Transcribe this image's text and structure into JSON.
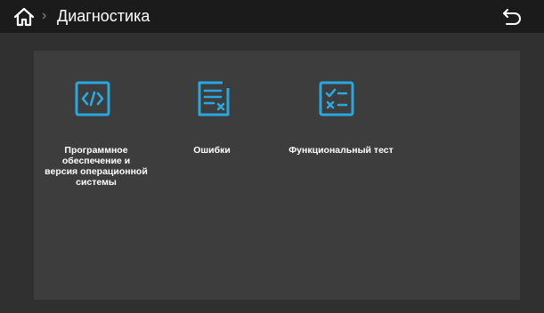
{
  "header": {
    "home_icon": "home-icon",
    "separator": "›",
    "title": "Диагностика",
    "back_icon": "back-arrow-icon"
  },
  "colors": {
    "header_bg": "#1b1b1b",
    "screen_bg": "#303030",
    "panel_bg": "#3d3d3d",
    "icon_accent": "#29a8e0",
    "text": "#ffffff"
  },
  "tiles": [
    {
      "icon": "code-icon",
      "label": "Программное\nобеспечение и\nверсия операционной\nсистемы"
    },
    {
      "icon": "error-list-icon",
      "label": "Ошибки"
    },
    {
      "icon": "checklist-icon",
      "label": "Функциональный тест"
    }
  ]
}
